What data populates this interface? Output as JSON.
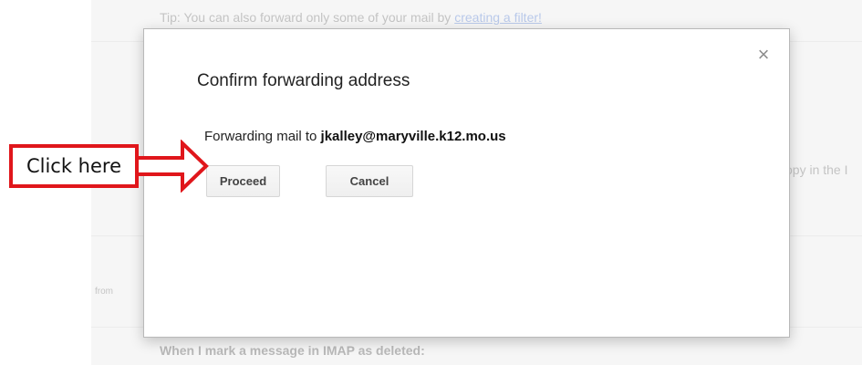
{
  "background": {
    "tip_text": "Tip: You can also forward only some of your mail by ",
    "tip_link": "creating a filter!",
    "copy_text": "opy in the I",
    "from_text": "from",
    "imap_text": "When I mark a message in IMAP as deleted:"
  },
  "dialog": {
    "title": "Confirm forwarding address",
    "message_prefix": "Forwarding mail to ",
    "email": "jkalley@maryville.k12.mo.us",
    "close_glyph": "×",
    "proceed_label": "Proceed",
    "cancel_label": "Cancel"
  },
  "annotation": {
    "label": "Click here",
    "color": "#e0161b"
  }
}
